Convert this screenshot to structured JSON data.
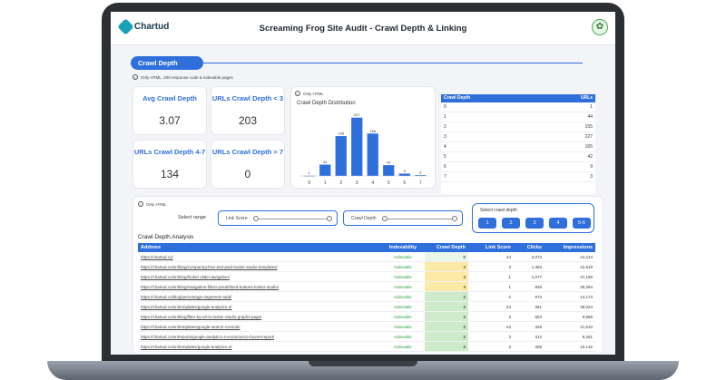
{
  "header": {
    "logo_text": "Chartud",
    "title": "Screaming Frog Site Audit - Crawl Depth & Linking"
  },
  "section": {
    "label": "Crawl Depth",
    "note": "Only HTML, 200 response code & indexable pages"
  },
  "kpis": [
    {
      "label": "Avg Crawl Depth",
      "value": "3.07"
    },
    {
      "label": "URLs Crawl Depth < 3",
      "value": "203"
    },
    {
      "label": "URLs Crawl Depth 4-7",
      "value": "134"
    },
    {
      "label": "URLs Crawl Depth > 7",
      "value": "0"
    }
  ],
  "chart_note": "Only HTML",
  "chart_data": {
    "type": "bar",
    "title": "Crawl Depth Distribution",
    "categories": [
      "0",
      "1",
      "2",
      "3",
      "4",
      "5",
      "6",
      "7"
    ],
    "values": [
      1,
      44,
      155,
      227,
      165,
      42,
      9,
      3
    ],
    "ylim": [
      0,
      240
    ]
  },
  "depth_table": {
    "headers": [
      "Crawl Depth",
      "URLs"
    ],
    "rows": [
      [
        "0",
        "1"
      ],
      [
        "1",
        "44"
      ],
      [
        "2",
        "155"
      ],
      [
        "3",
        "227"
      ],
      [
        "4",
        "165"
      ],
      [
        "5",
        "42"
      ],
      [
        "6",
        "9"
      ],
      [
        "7",
        "3"
      ]
    ]
  },
  "filters": {
    "note": "Only HTML",
    "select_range_label": "Select range",
    "link_score_label": "Link Score",
    "crawl_depth_label": "Crawl Depth",
    "select_depth_label": "Select crawl depth",
    "depth_buttons": [
      "1",
      "2",
      "3",
      "4",
      "5-6"
    ]
  },
  "analysis": {
    "title": "Crawl Depth Analysis",
    "headers": [
      "Address",
      "Indexability",
      "Crawl Depth",
      "Link Score",
      "Clicks",
      "Impressions"
    ],
    "rows": [
      [
        "https://chartud.co/",
        "Indexable",
        "0",
        "44",
        "2,073",
        "44,213"
      ],
      [
        "https://chartud.co/en/blog/comparing-free-and-paid-looker-studio-templates/",
        "Indexable",
        "4",
        "3",
        "1,383",
        "42,818"
      ],
      [
        "https://chartud.co/en/blog/looker-slide-navigation/",
        "Indexable",
        "4",
        "1",
        "1,077",
        "47,199"
      ],
      [
        "https://chartud.co/en/blog/navigation-filters-predefined-buttons-looker-studio/",
        "Indexable",
        "4",
        "1",
        "835",
        "30,294"
      ],
      [
        "https://chartud.co/blog/percentage-segments-total/",
        "Indexable",
        "2",
        "2",
        "673",
        "14,173"
      ],
      [
        "https://chartud.co/en/templates/google-analytics-4/",
        "Indexable",
        "2",
        "24",
        "281",
        "36,024"
      ],
      [
        "https://chartud.co/en/blog/filter-by-url-in-looker-studio-graphs-page/",
        "Indexable",
        "2",
        "3",
        "553",
        "9,659"
      ],
      [
        "https://chartud.co/en/templates/google-search-console/",
        "Indexable",
        "2",
        "24",
        "325",
        "21,510"
      ],
      [
        "https://chartud.co/en/reports/google-analytics-4-ecommerce-funnel-report/",
        "Indexable",
        "2",
        "3",
        "312",
        "9,261"
      ],
      [
        "https://chartud.co/en/templates/google-analytics-4/",
        "Indexable",
        "2",
        "3",
        "289",
        "10,132"
      ]
    ]
  }
}
